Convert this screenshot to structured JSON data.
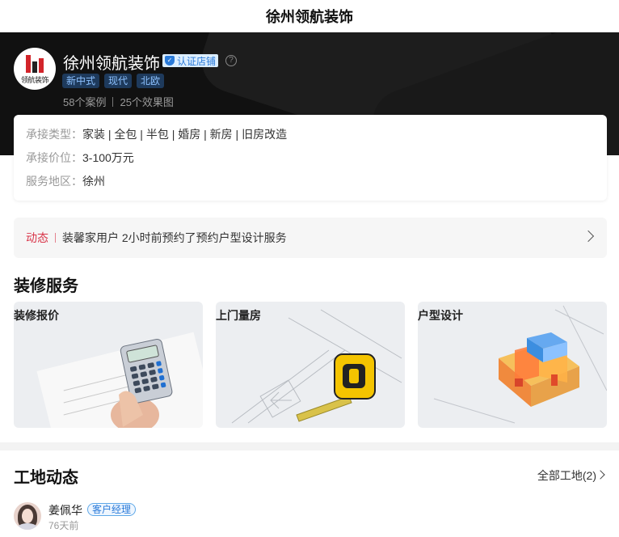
{
  "page": {
    "title": "徐州领航装饰"
  },
  "shop": {
    "logo_text": "领航装饰",
    "name": "徐州领航装饰",
    "verified_label": "认证店铺",
    "help_glyph": "?",
    "tags": [
      "新中式",
      "现代",
      "北欧"
    ],
    "stats": {
      "cases": "58个案例",
      "renders": "25个效果图"
    }
  },
  "info": {
    "type_label": "承接类型：",
    "type_value": "家装 | 全包 | 半包 | 婚房 | 新房 | 旧房改造",
    "price_label": "承接价位：",
    "price_value": "3-100万元",
    "area_label": "服务地区：",
    "area_value": "徐州"
  },
  "feed": {
    "keyword": "动态",
    "message": "装馨家用户 2小时前预约了预约户型设计服务"
  },
  "services": {
    "section_title": "装修服务",
    "items": [
      {
        "label": "装修报价",
        "icon": "calculator-icon"
      },
      {
        "label": "上门量房",
        "icon": "tape-measure-icon"
      },
      {
        "label": "户型设计",
        "icon": "floorplan-3d-icon"
      }
    ]
  },
  "sites": {
    "section_title": "工地动态",
    "all_link": "全部工地(2)",
    "manager": {
      "name": "姜佩华",
      "role": "客户经理",
      "time": "76天前"
    }
  },
  "colors": {
    "accent_red": "#d9364a",
    "accent_blue": "#2a7ad8",
    "hero_bg": "#111111"
  }
}
